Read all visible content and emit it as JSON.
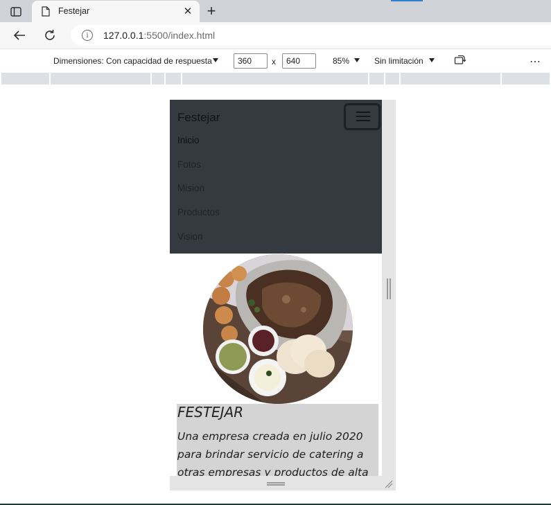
{
  "browser": {
    "tab_title": "Festejar",
    "new_tab_symbol": "+",
    "close_symbol": "✕",
    "url_host": "127.0.0.1",
    "url_path": ":5500/index.html"
  },
  "devtools": {
    "dimensions_label": "Dimensiones: Con capacidad de respuesta",
    "width_value": "360",
    "times_symbol": "x",
    "height_value": "640",
    "zoom": "85%",
    "throttling": "Sin limitación",
    "more_symbol": "⋯"
  },
  "site": {
    "brand": "Festejar",
    "nav": [
      {
        "label": "Inicio"
      },
      {
        "label": "Fotos"
      },
      {
        "label": "Mision"
      },
      {
        "label": "Productos"
      },
      {
        "label": "Vision"
      }
    ],
    "caption_title": "FESTEJAR",
    "caption_text": "Una empresa creada en julio 2020 para brindar servicio de catering a otras empresas y productos de alta"
  },
  "colors": {
    "navbar_bg": "#343a40",
    "caption_bg": "#d4d4d4",
    "tab_accent": "#2d7fd3"
  }
}
